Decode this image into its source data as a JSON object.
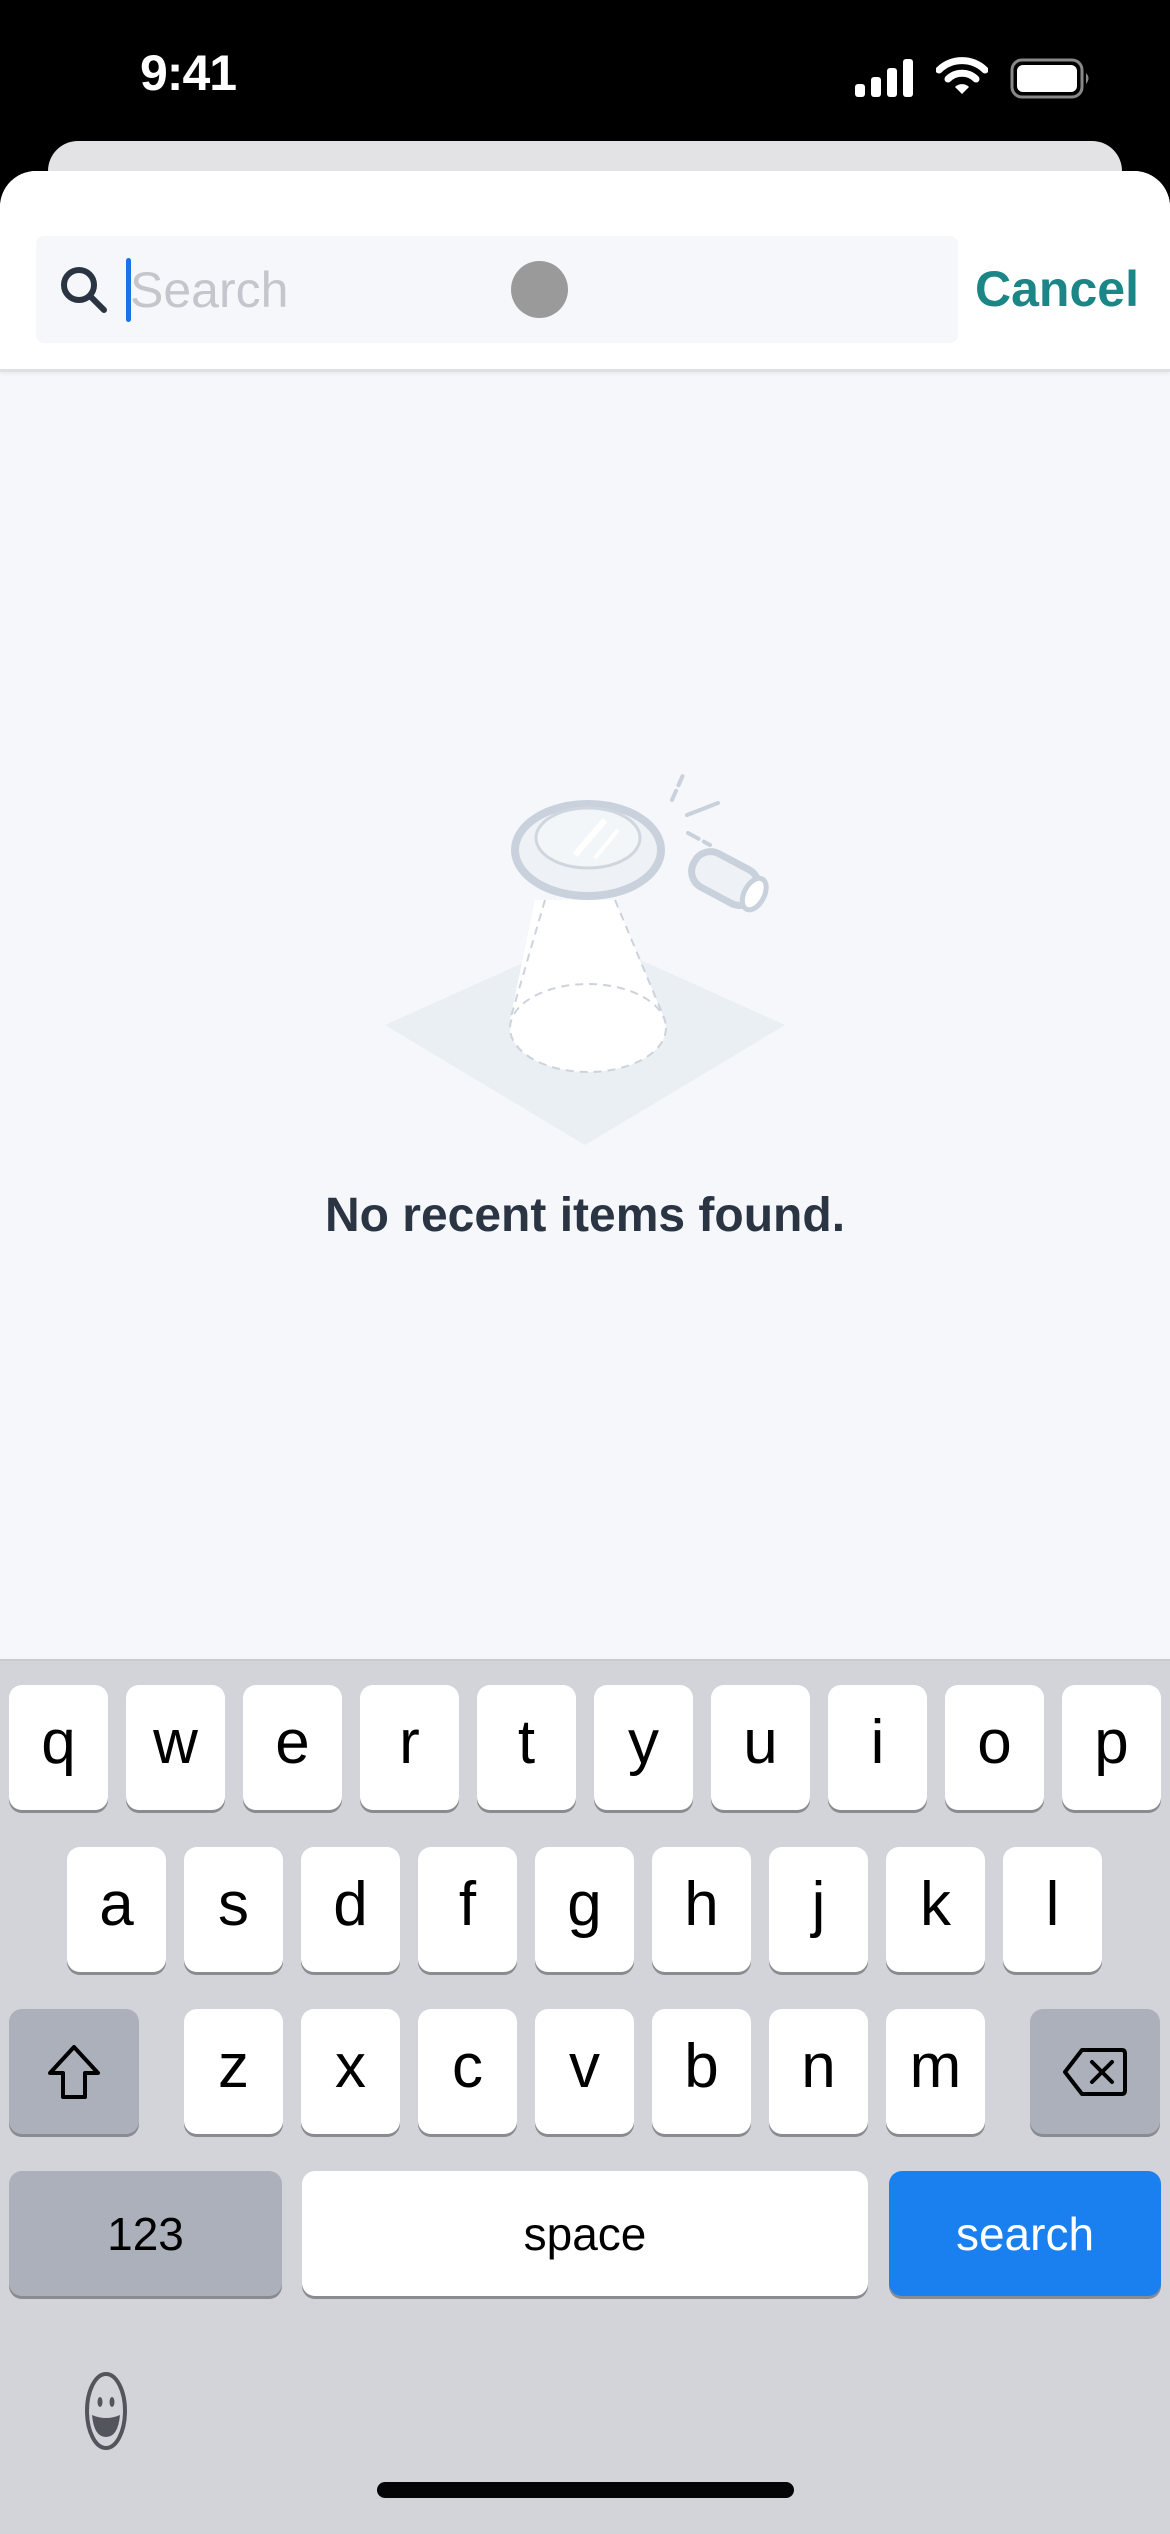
{
  "status_bar": {
    "time": "9:41",
    "icons": [
      "cellular-signal-icon",
      "wifi-icon",
      "battery-icon"
    ]
  },
  "search": {
    "placeholder": "Search",
    "value": "",
    "icon": "search-icon",
    "cancel_label": "Cancel"
  },
  "empty_state": {
    "illustration": "magnifying-glass-spotlight-icon",
    "message": "No recent items found."
  },
  "keyboard": {
    "row1": [
      "q",
      "w",
      "e",
      "r",
      "t",
      "y",
      "u",
      "i",
      "o",
      "p"
    ],
    "row2": [
      "a",
      "s",
      "d",
      "f",
      "g",
      "h",
      "j",
      "k",
      "l"
    ],
    "row3": [
      "z",
      "x",
      "c",
      "v",
      "b",
      "n",
      "m"
    ],
    "shift_icon": "shift-icon",
    "delete_icon": "delete-backspace-icon",
    "numbers_label": "123",
    "space_label": "space",
    "return_label": "search",
    "emoji_icon": "emoji-icon"
  },
  "colors": {
    "accent": "#1c8585",
    "keyboard_return": "#1a80f0",
    "caret": "#1a73e8",
    "text_primary": "#2b3443"
  }
}
